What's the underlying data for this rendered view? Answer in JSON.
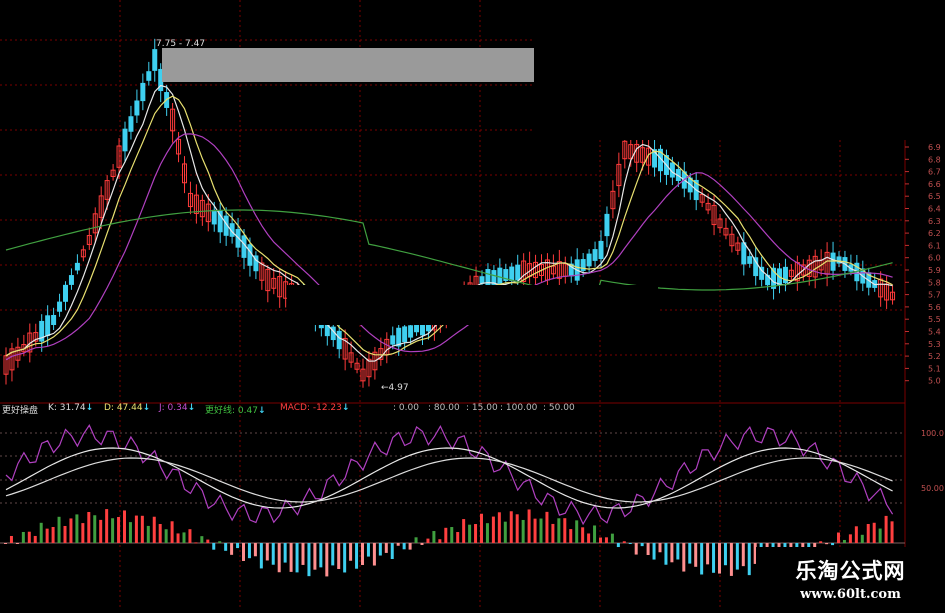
{
  "price_panel": {
    "high_label": "7.75 - 7.47",
    "low_label": "4.97",
    "y_axis_ticks": [
      "6.9",
      "6.8",
      "6.7",
      "6.6",
      "6.5",
      "6.4",
      "6.3",
      "6.2",
      "6.1",
      "6.0",
      "5.9",
      "5.8",
      "5.7",
      "5.6",
      "5.5",
      "5.4",
      "5.3",
      "5.2",
      "5.1",
      "5.0"
    ]
  },
  "indicator_header": {
    "name": "更好操盘",
    "k_label": "K: 31.74",
    "d_label": "D: 47.44",
    "j_label": "J: 0.34",
    "better_line_label": "更好线: 0.47",
    "macd_label": "MACD: -12.23",
    "arrow_glyph": "↓",
    "levels": [
      "0.00",
      "80.00",
      "15.00",
      "100.00",
      "50.00"
    ]
  },
  "indicator_axis_ticks": [
    "100.0",
    "50.00"
  ],
  "watermark": {
    "title": "乐淘公式网",
    "url": "www.60lt.com"
  },
  "colors": {
    "background": "#000000",
    "bull_candle": "#ff3b3b",
    "bear_candle": "#3fd0f0",
    "ma_white": "#e8e8e8",
    "ma_yellow": "#e8e070",
    "ma_purple": "#b040c0",
    "ma_green": "#40a040",
    "grid": "#7a0000"
  }
}
